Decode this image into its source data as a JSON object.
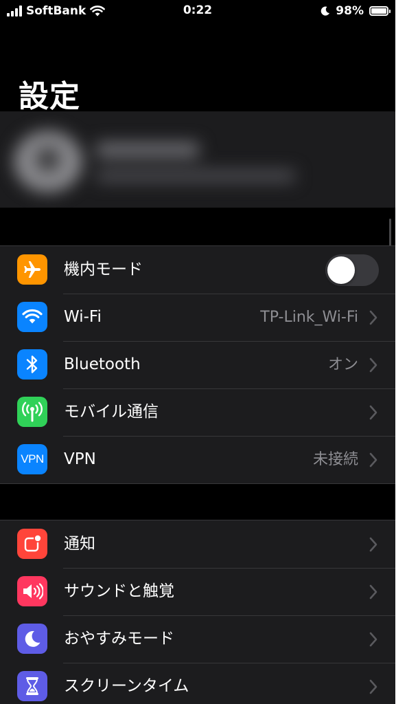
{
  "status_bar": {
    "carrier": "SoftBank",
    "time": "0:22",
    "battery_percent": "98%",
    "battery_level": 0.98
  },
  "page_title": "設定",
  "group1": [
    {
      "label": "機内モード",
      "icon": "airplane-icon",
      "icon_color": "#ff9500",
      "toggle_on": false
    },
    {
      "label": "Wi-Fi",
      "value": "TP-Link_Wi-Fi",
      "icon": "wifi-icon",
      "icon_color": "#0a84ff"
    },
    {
      "label": "Bluetooth",
      "value": "オン",
      "icon": "bluetooth-icon",
      "icon_color": "#0a84ff"
    },
    {
      "label": "モバイル通信",
      "icon": "cellular-antenna-icon",
      "icon_color": "#30d158"
    },
    {
      "label": "VPN",
      "value": "未接続",
      "icon": "vpn-icon",
      "icon_text": "VPN",
      "icon_color": "#0a84ff"
    }
  ],
  "group2": [
    {
      "label": "通知",
      "icon": "notification-icon",
      "icon_color": "#ff453a"
    },
    {
      "label": "サウンドと触覚",
      "icon": "speaker-icon",
      "icon_color": "#ff375f"
    },
    {
      "label": "おやすみモード",
      "icon": "moon-icon",
      "icon_color": "#5e5ce6"
    },
    {
      "label": "スクリーンタイム",
      "icon": "hourglass-icon",
      "icon_color": "#5e5ce6"
    }
  ]
}
